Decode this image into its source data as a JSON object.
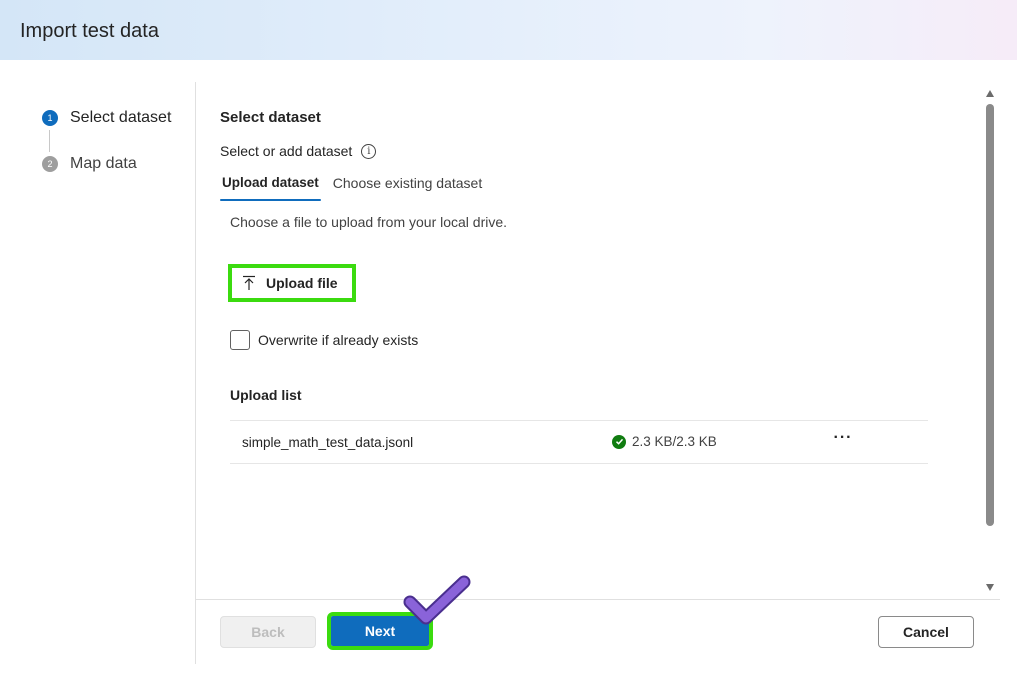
{
  "dialog": {
    "title": "Import test data"
  },
  "stepper": {
    "steps": [
      {
        "number": "1",
        "label": "Select dataset",
        "state": "active"
      },
      {
        "number": "2",
        "label": "Map data",
        "state": "inactive"
      }
    ]
  },
  "content": {
    "section_title": "Select dataset",
    "field_label": "Select or add dataset",
    "info_icon": "info-icon",
    "tabs": [
      {
        "label": "Upload dataset",
        "selected": true
      },
      {
        "label": "Choose existing dataset",
        "selected": false
      }
    ],
    "help_text": "Choose a file to upload from your local drive.",
    "upload_button": {
      "label": "Upload file",
      "icon": "upload-icon"
    },
    "overwrite_checkbox": {
      "label": "Overwrite if already exists",
      "checked": false
    },
    "upload_list": {
      "title": "Upload list",
      "items": [
        {
          "file_name": "simple_math_test_data.jsonl",
          "status": "2.3 KB/2.3 KB",
          "status_icon": "success-check-icon",
          "more": "···"
        }
      ]
    }
  },
  "footer": {
    "back_label": "Back",
    "next_label": "Next",
    "cancel_label": "Cancel"
  },
  "colors": {
    "accent": "#0f6cbd",
    "highlight": "#3bdb0f",
    "success": "#107c10",
    "overlay_check": "#7b52c8"
  }
}
